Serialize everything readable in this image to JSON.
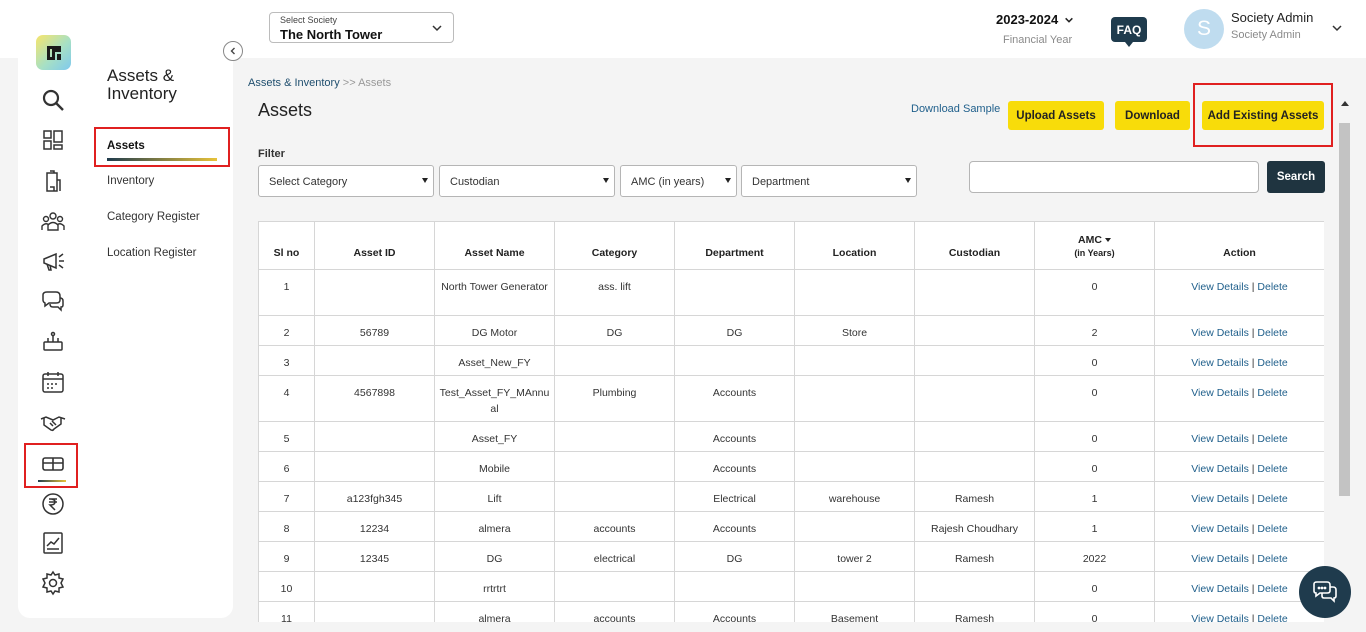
{
  "header": {
    "society_label": "Select Society",
    "society_value": "The North Tower",
    "year": "2023-2024",
    "year_sub": "Financial Year",
    "faq": "FAQ",
    "avatar_letter": "S",
    "user_name": "Society Admin",
    "user_role": "Society Admin"
  },
  "sidebar": {
    "title": "Assets & Inventory",
    "items": [
      {
        "label": "Assets"
      },
      {
        "label": "Inventory"
      },
      {
        "label": "Category Register"
      },
      {
        "label": "Location Register"
      }
    ],
    "icons": [
      "search-icon",
      "dashboard-icon",
      "building-icon",
      "members-icon",
      "announcement-icon",
      "chat-icon",
      "facility-icon",
      "calendar-icon",
      "handshake-icon",
      "assets-icon",
      "rupee-icon",
      "report-icon",
      "settings-icon"
    ]
  },
  "breadcrumb": {
    "parent": "Assets & Inventory",
    "separator": ">>",
    "current": "Assets"
  },
  "page": {
    "title": "Assets",
    "download_sample": "Download Sample",
    "upload": "Upload Assets",
    "download": "Download",
    "add_existing": "Add Existing Assets"
  },
  "filters": {
    "label": "Filter",
    "category": "Select Category",
    "custodian": "Custodian",
    "amc": "AMC (in years)",
    "department": "Department",
    "search_button": "Search"
  },
  "table": {
    "headers": {
      "sl": "Sl no",
      "asset_id": "Asset ID",
      "asset_name": "Asset Name",
      "category": "Category",
      "department": "Department",
      "location": "Location",
      "custodian": "Custodian",
      "amc": "AMC",
      "amc_sub": "(in Years)",
      "action": "Action"
    },
    "view_label": "View Details",
    "delete_label": "Delete",
    "rows": [
      {
        "sl": "1",
        "asset_id": "",
        "name": "North Tower Generator",
        "category": "ass. lift",
        "department": "",
        "location": "",
        "custodian": "",
        "amc": "0"
      },
      {
        "sl": "2",
        "asset_id": "56789",
        "name": "DG Motor",
        "category": "DG",
        "department": "DG",
        "location": "Store",
        "custodian": "",
        "amc": "2"
      },
      {
        "sl": "3",
        "asset_id": "",
        "name": "Asset_New_FY",
        "category": "",
        "department": "",
        "location": "",
        "custodian": "",
        "amc": "0"
      },
      {
        "sl": "4",
        "asset_id": "4567898",
        "name": "Test_Asset_FY_MAnnual",
        "category": "Plumbing",
        "department": "Accounts",
        "location": "",
        "custodian": "",
        "amc": "0"
      },
      {
        "sl": "5",
        "asset_id": "",
        "name": "Asset_FY",
        "category": "",
        "department": "Accounts",
        "location": "",
        "custodian": "",
        "amc": "0"
      },
      {
        "sl": "6",
        "asset_id": "",
        "name": "Mobile",
        "category": "",
        "department": "Accounts",
        "location": "",
        "custodian": "",
        "amc": "0"
      },
      {
        "sl": "7",
        "asset_id": "a123fgh345",
        "name": "Lift",
        "category": "",
        "department": "Electrical",
        "location": "warehouse",
        "custodian": "Ramesh",
        "amc": "1"
      },
      {
        "sl": "8",
        "asset_id": "12234",
        "name": "almera",
        "category": "accounts",
        "department": "Accounts",
        "location": "",
        "custodian": "Rajesh Choudhary",
        "amc": "1"
      },
      {
        "sl": "9",
        "asset_id": "12345",
        "name": "DG",
        "category": "electrical",
        "department": "DG",
        "location": "tower 2",
        "custodian": "Ramesh",
        "amc": "2022"
      },
      {
        "sl": "10",
        "asset_id": "",
        "name": "rrtrtrt",
        "category": "",
        "department": "",
        "location": "",
        "custodian": "",
        "amc": "0"
      },
      {
        "sl": "11",
        "asset_id": "",
        "name": "almera",
        "category": "accounts",
        "department": "Accounts",
        "location": "Basement",
        "custodian": "Ramesh",
        "amc": "0"
      }
    ]
  },
  "colors": {
    "accent_yellow": "#f8dc0a",
    "dark_navy": "#1f3b4d",
    "highlight_red": "#e02020",
    "link_blue": "#1f5f8b"
  }
}
